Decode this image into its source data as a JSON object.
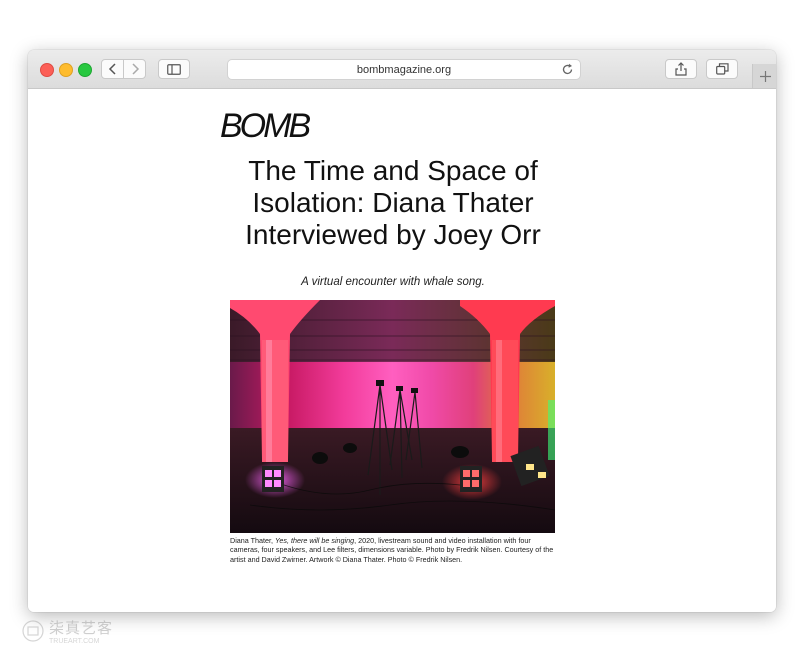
{
  "browser": {
    "url": "bombmagazine.org",
    "buttons": {
      "back": "chevron-left-icon",
      "forward": "chevron-right-icon",
      "sidebar": "sidebar-icon",
      "reload": "reload-icon",
      "share": "share-icon",
      "tabs": "tabs-icon",
      "new_tab": "plus-icon"
    }
  },
  "article": {
    "logo": "BOMB",
    "headline_lines": [
      "The Time and Space of",
      "Isolation: Diana Thater",
      "Interviewed by Joey Orr"
    ],
    "subhead": "A virtual encounter with whale song.",
    "caption": {
      "artist": "Diana Thater, ",
      "title": "Yes, there will be singing",
      "details": ", 2020, livestream sound and video installation with four cameras, four speakers, and Lee filters, dimensions variable. Photo by Fredrik Nilsen. Courtesy of the artist and David Zwirner. Artwork © Diana Thater. Photo © Fredrik Nilsen."
    }
  },
  "watermark": {
    "main": "柒真艺客",
    "sub": "TRUEART.COM"
  }
}
